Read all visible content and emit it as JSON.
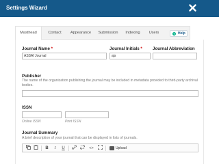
{
  "window": {
    "title": "Settings Wizard",
    "close_icon": "close-icon"
  },
  "tabs": [
    {
      "label": "Masthead",
      "active": true
    },
    {
      "label": "Contact",
      "active": false
    },
    {
      "label": "Appearance",
      "active": false
    },
    {
      "label": "Submission",
      "active": false
    },
    {
      "label": "Indexing",
      "active": false
    },
    {
      "label": "Users",
      "active": false
    }
  ],
  "help": {
    "label": "Help",
    "icon": "help-icon"
  },
  "form": {
    "journal_name": {
      "label": "Journal Name",
      "required_mark": "*",
      "value": "ASSAf Journal"
    },
    "journal_initials": {
      "label": "Journal Initials",
      "required_mark": "*",
      "value": "ajs"
    },
    "journal_abbreviation": {
      "label": "Journal Abbreviation",
      "value": ""
    },
    "publisher": {
      "label": "Publisher",
      "description": "The name of the organization publishing the journal may be included in metadata provided to third-party archival bodies.",
      "value": ""
    },
    "issn": {
      "label": "ISSN",
      "online_label": "Online ISSN",
      "print_label": "Print ISSN",
      "online_value": "",
      "print_value": ""
    },
    "journal_summary": {
      "label": "Journal Summary",
      "description": "A brief description of your journal that can be displayed in lists of journals."
    }
  },
  "editor_toolbar": {
    "icons": [
      "copy-icon",
      "paste-icon",
      "bold-icon",
      "italic-icon",
      "underline-icon",
      "link-icon",
      "unlink-icon",
      "code-icon",
      "fullscreen-icon",
      "image-icon"
    ],
    "upload_label": "Upload",
    "colors": {
      "toolbar_border": "#c8c8c8"
    }
  },
  "colors": {
    "header": "#15598a",
    "required": "#d00a0a",
    "help_dot": "#00b28a"
  }
}
